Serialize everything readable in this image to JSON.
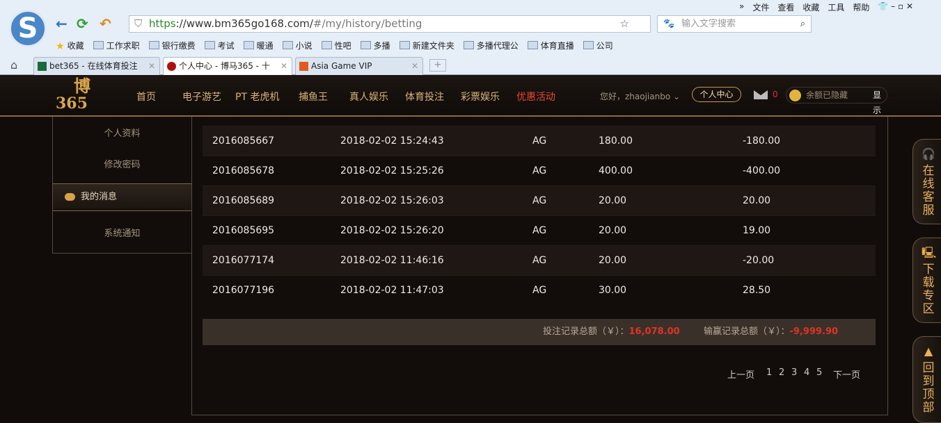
{
  "browser": {
    "menu": [
      "»",
      "文件",
      "查看",
      "收藏",
      "工具",
      "帮助"
    ],
    "url_scheme": "https",
    "url_host": "://www.bm365go168.com/",
    "url_path": "#/my/history/betting",
    "search_placeholder": "输入文字搜索",
    "bookmarks": [
      "收藏",
      "工作求职",
      "银行缴费",
      "考试",
      "暖通",
      "小说",
      "性吧",
      "多播",
      "新建文件夹",
      "多播代理公",
      "体育直播",
      "公司"
    ],
    "tabs": [
      {
        "label": "bet365 - 在线体育投注"
      },
      {
        "label": "个人中心 - 博马365 - 十"
      },
      {
        "label": "Asia Game VIP"
      }
    ]
  },
  "site": {
    "logo": "博马365",
    "nav": [
      "首页",
      "电子游艺",
      "PT 老虎机",
      "捕鱼王",
      "真人娱乐",
      "体育投注",
      "彩票娱乐",
      "优惠活动"
    ],
    "greeting": "您好，zhaojianbo",
    "personal_center": "个人中心",
    "mail_count": "0",
    "balance_hidden": "余额已隐藏",
    "show": "显示"
  },
  "sidebar": {
    "items": [
      "个人资料",
      "修改密码",
      "我的消息",
      "系统通知"
    ]
  },
  "table": {
    "rows": [
      [
        "2016085667",
        "2018-02-02 15:24:43",
        "AG",
        "180.00",
        "-180.00"
      ],
      [
        "2016085678",
        "2018-02-02 15:25:26",
        "AG",
        "400.00",
        "-400.00"
      ],
      [
        "2016085689",
        "2018-02-02 15:26:03",
        "AG",
        "20.00",
        "20.00"
      ],
      [
        "2016085695",
        "2018-02-02 15:26:20",
        "AG",
        "20.00",
        "19.00"
      ],
      [
        "2016077174",
        "2018-02-02 11:46:16",
        "AG",
        "20.00",
        "-20.00"
      ],
      [
        "2016077196",
        "2018-02-02 11:47:03",
        "AG",
        "30.00",
        "28.50"
      ]
    ]
  },
  "summary": {
    "bet_label": "投注记录总额（￥）：",
    "bet_total": "16,078.00",
    "win_label": "输赢记录总额（￥）：",
    "win_total": "-9,999.90"
  },
  "pager": {
    "prev": "上一页",
    "pages": [
      "1",
      "2",
      "3",
      "4",
      "5"
    ],
    "next": "下一页"
  },
  "float": {
    "service": "在线客服",
    "download": "下载专区",
    "top": "回到顶部"
  }
}
